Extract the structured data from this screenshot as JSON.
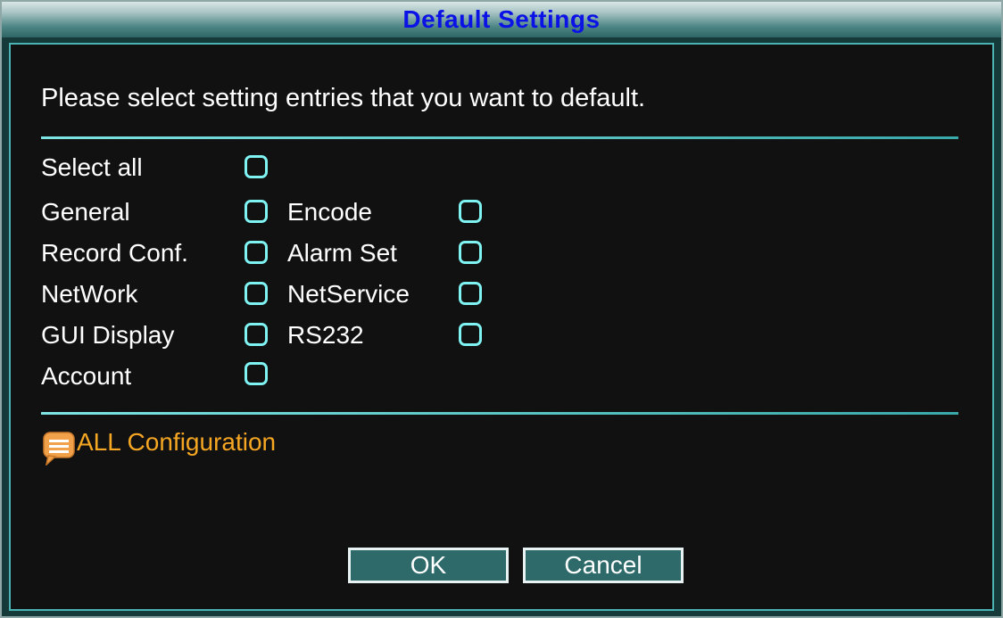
{
  "dialog": {
    "title": "Default Settings",
    "prompt": "Please select setting entries that you want to default.",
    "select_all_label": "Select all",
    "items": {
      "general": "General",
      "encode": "Encode",
      "record_conf": "Record Conf.",
      "alarm_set": "Alarm Set",
      "network": "NetWork",
      "netservice": "NetService",
      "gui_display": "GUI Display",
      "rs232": "RS232",
      "account": "Account"
    },
    "hint_text": "ALL Configuration",
    "ok_label": "OK",
    "cancel_label": "Cancel"
  },
  "icons": {
    "hint": "speech-bubble-icon",
    "checkbox": "checkbox-unchecked-icon"
  },
  "colors": {
    "title_text": "#0b12e6",
    "accent": "#7ff2f2",
    "hint_text": "#f5a623",
    "button_bg": "#2f6a6a"
  }
}
